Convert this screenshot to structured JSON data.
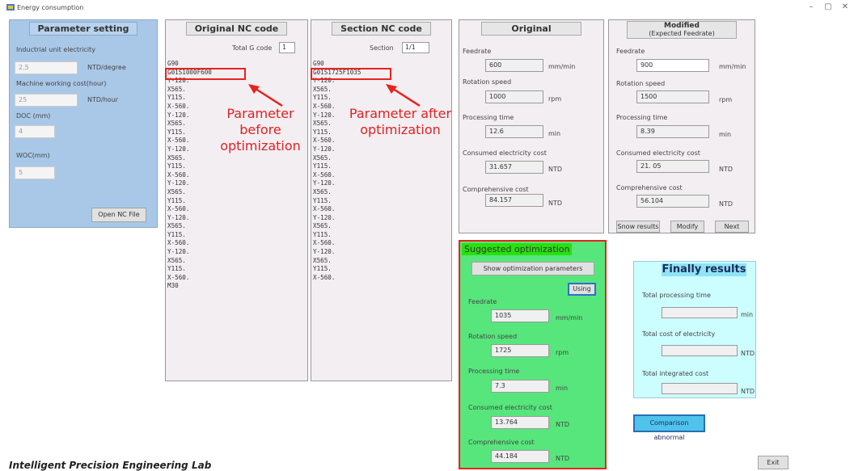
{
  "window": {
    "title": "Energy consumption",
    "minimize": "–",
    "maximize": "▢",
    "close": "✕"
  },
  "param": {
    "header": "Parameter setting",
    "elec_label": "Inductrial unit electricity",
    "elec_value": "2.5",
    "elec_unit": "NTD/degree",
    "mach_label": "Machine working cost(hour)",
    "mach_value": "25",
    "mach_unit": "NTD/hour",
    "doc_label": "DOC (mm)",
    "doc_value": "4",
    "woc_label": "WOC(mm)",
    "woc_value": "5",
    "open_btn": "Open NC File"
  },
  "original_nc": {
    "header": "Original NC code",
    "total_label": "Total G code",
    "total_value": "1",
    "lines": [
      "G90",
      "G01S1000F600",
      "Y-120.",
      "X565.",
      "Y115.",
      "X-560.",
      "Y-120.",
      "X565.",
      "Y115.",
      "X-560.",
      "Y-120.",
      "X565.",
      "Y115.",
      "X-560.",
      "Y-120.",
      "X565.",
      "Y115.",
      "X-560.",
      "Y-120.",
      "X565.",
      "Y115.",
      "X-560.",
      "Y-120.",
      "X565.",
      "Y115.",
      "X-560.",
      "M30"
    ]
  },
  "section_nc": {
    "header": "Section NC code",
    "section_label": "Section",
    "section_value": "1/1",
    "lines": [
      "G90",
      "G01S1725F1035",
      "Y-120.",
      "X565.",
      "Y115.",
      "X-560.",
      "Y-120.",
      "X565.",
      "Y115.",
      "X-560.",
      "Y-120.",
      "X565.",
      "Y115.",
      "X-560.",
      "Y-120.",
      "X565.",
      "Y115.",
      "X-560.",
      "Y-120.",
      "X565.",
      "Y115.",
      "X-560.",
      "Y-120.",
      "X565.",
      "Y115.",
      "X-560."
    ]
  },
  "annotations": {
    "before": "Parameter before optimization",
    "after": "Parameter after optimization"
  },
  "original": {
    "header": "Original",
    "feed_label": "Feedrate",
    "feed_value": "600",
    "feed_unit": "mm/min",
    "rot_label": "Rotation speed",
    "rot_value": "1000",
    "rot_unit": "rpm",
    "time_label": "Processing time",
    "time_value": "12.6",
    "time_unit": "min",
    "elec_label": "Consumed electricity cost",
    "elec_value": "31.657",
    "elec_unit": "NTD",
    "comp_label": "Comprehensive cost",
    "comp_value": "84.157",
    "comp_unit": "NTD"
  },
  "modified": {
    "header_1": "Modified",
    "header_2": "(Expected Feedrate)",
    "feed_label": "Feedrate",
    "feed_value": "900",
    "feed_unit": "mm/min",
    "rot_label": "Rotation speed",
    "rot_value": "1500",
    "rot_unit": "rpm",
    "time_label": "Processing time",
    "time_value": "8.39",
    "time_unit": "min",
    "elec_label": "Consumed electricity cost",
    "elec_value": "21. 05",
    "elec_unit": "NTD",
    "comp_label": "Comprehensive cost",
    "comp_value": "56.104",
    "comp_unit": "NTD",
    "show_btn": "Snow results",
    "modify_btn": "Modify",
    "next_btn": "Next"
  },
  "suggested": {
    "header": "Suggested optimization",
    "show_btn": "Show optimization parameters",
    "using_btn": "Using",
    "feed_label": "Feedrate",
    "feed_value": "1035",
    "feed_unit": "mm/min",
    "rot_label": "Rotation speed",
    "rot_value": "1725",
    "rot_unit": "rpm",
    "time_label": "Processing time",
    "time_value": "7.3",
    "time_unit": "min",
    "elec_label": "Consumed electricity cost",
    "elec_value": "13.764",
    "elec_unit": "NTD",
    "comp_label": "Comprehensive cost",
    "comp_value": "44.184",
    "comp_unit": "NTD"
  },
  "final": {
    "header": "Finally results",
    "time_label": "Total processing time",
    "time_value": "",
    "time_unit": "min",
    "elec_label": "Total cost of electricity",
    "elec_value": "",
    "elec_unit": "NTD",
    "integ_label": "Total integrated cost",
    "integ_value": "",
    "integ_unit": "NTD"
  },
  "comparison_btn": "Comparison abnormal",
  "exit_btn": "Exit",
  "footer": "Intelligent Precision Engineering Lab",
  "colors": {
    "param_bg": "#a9c8e8",
    "suggested_bg": "#57e67c",
    "suggested_hdr": "#28e00f",
    "final_bg": "#ccfdff",
    "final_hdr": "#8fe3f5",
    "comparison_bg": "#4fc3eb",
    "annotation_red": "#e8231d"
  }
}
